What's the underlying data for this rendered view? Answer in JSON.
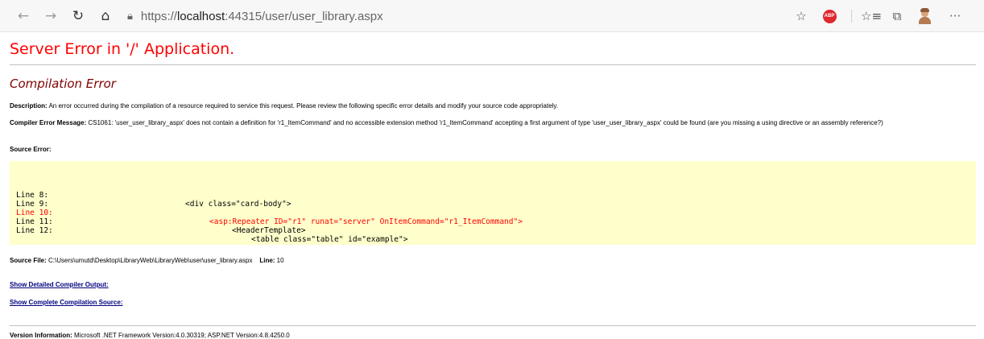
{
  "browser": {
    "url_prefix": "https://",
    "url_host": "localhost",
    "url_rest": ":44315/user/user_library.aspx",
    "abp_label": "ABP",
    "more_label": "···"
  },
  "error_page": {
    "title": "Server Error in '/' Application.",
    "subtitle": "Compilation Error",
    "description_label": "Description:",
    "description_text": " An error occurred during the compilation of a resource required to service this request. Please review the following specific error details and modify your source code appropriately.",
    "compiler_message_label": "Compiler Error Message:",
    "compiler_message_text": " CS1061: 'user_user_library_aspx' does not contain a definition for 'r1_ItemCommand' and no accessible extension method 'r1_ItemCommand' accepting a first argument of type 'user_user_library_aspx' could be found (are you missing a using directive or an assembly reference?)",
    "source_error_label": "Source Error:",
    "code_lines": [
      {
        "number": "Line 8:",
        "code": "<div class=\"card-body\">",
        "indent": 0,
        "error": false
      },
      {
        "number": "Line 9:",
        "code": "",
        "indent": 0,
        "error": false
      },
      {
        "number": "Line 10:",
        "code": "<asp:Repeater ID=\"r1\" runat=\"server\" OnItemCommand=\"r1_ItemCommand\">",
        "indent": 1,
        "error": true
      },
      {
        "number": "Line 11:",
        "code": "<HeaderTemplate>",
        "indent": 2,
        "error": false
      },
      {
        "number": "Line 12:",
        "code": "<table class=\"table\" id=\"example\">",
        "indent": 3,
        "error": false
      }
    ],
    "source_file_label": "Source File:",
    "source_file_path": " C:\\Users\\umutd\\Desktop\\LibraryWeb\\LibraryWeb\\user\\user_library.aspx",
    "line_label": "Line:",
    "line_value": " 10",
    "link_detailed": "Show Detailed Compiler Output:",
    "link_complete": "Show Complete Compilation Source:",
    "version_label": "Version Information:",
    "version_text": " Microsoft .NET Framework Version:4.0.30319; ASP.NET Version:4.8.4250.0"
  },
  "colors": {
    "title_red": "#ff0000",
    "subtitle_maroon": "#800000",
    "code_background": "#ffffcc",
    "link_navy": "#000080"
  }
}
